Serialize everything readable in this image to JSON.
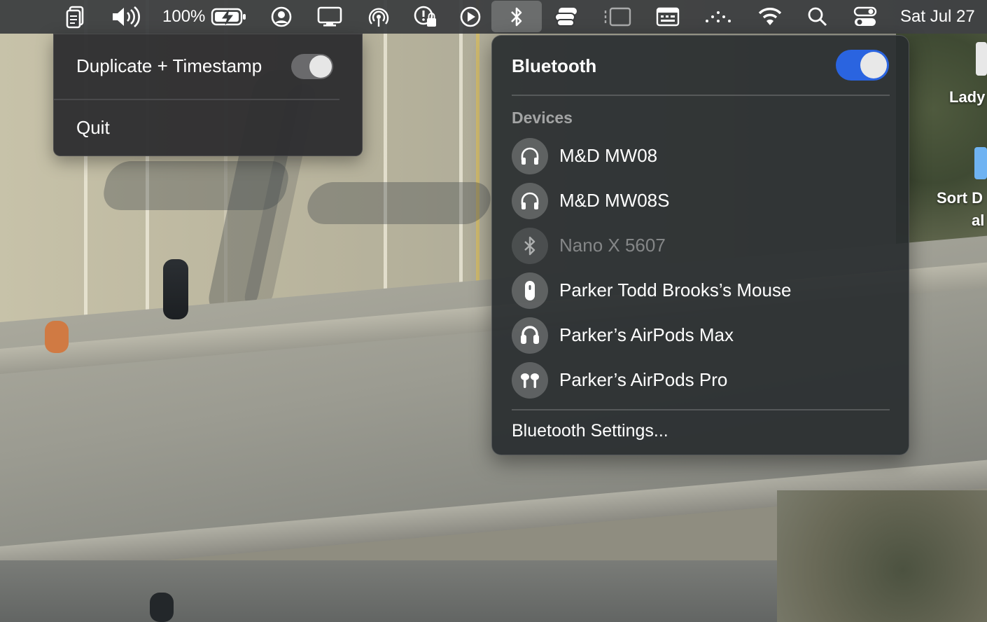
{
  "menubar": {
    "battery_percent": "100%",
    "date_text": "Sat Jul 27",
    "icons": [
      "clipboard-icon",
      "volume-icon",
      "battery-charging-icon",
      "user-icon",
      "display-icon",
      "airdrop-icon",
      "lock-status-icon",
      "play-icon",
      "bluetooth-icon",
      "stage-manager-icon",
      "sidebar-icon",
      "keyboard-icon",
      "dots-icon",
      "wifi-icon",
      "search-icon",
      "control-center-icon"
    ]
  },
  "menu_left": {
    "item1_label": "Duplicate + Timestamp",
    "item1_toggle": false,
    "item2_label": "Quit"
  },
  "bluetooth": {
    "title": "Bluetooth",
    "enabled": true,
    "section_label": "Devices",
    "devices": [
      {
        "name": "M&D MW08",
        "icon": "headphones-icon",
        "connected": true
      },
      {
        "name": "M&D MW08S",
        "icon": "headphones-icon",
        "connected": true
      },
      {
        "name": "Nano X 5607",
        "icon": "bluetooth-icon",
        "connected": false
      },
      {
        "name": "Parker Todd Brooks’s Mouse",
        "icon": "mouse-icon",
        "connected": true
      },
      {
        "name": "Parker’s AirPods Max",
        "icon": "airpods-max-icon",
        "connected": true
      },
      {
        "name": "Parker’s AirPods Pro",
        "icon": "airpods-pro-icon",
        "connected": true
      }
    ],
    "settings_label": "Bluetooth Settings..."
  },
  "desktop": {
    "label1": "Lady",
    "label2_line1": "Sort D",
    "label2_line2": "al"
  }
}
